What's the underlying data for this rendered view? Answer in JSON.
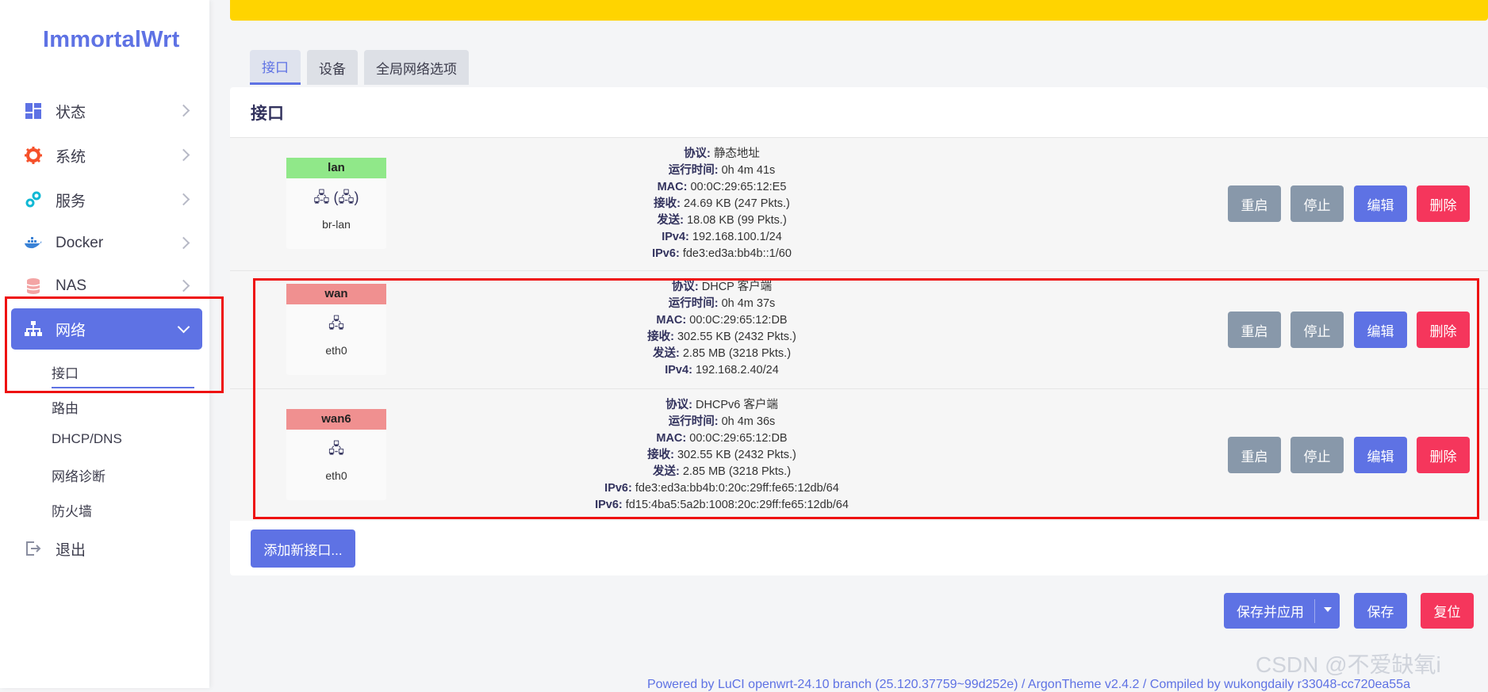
{
  "app": {
    "logo": "ImmortalWrt"
  },
  "sidebar": {
    "items": [
      {
        "label": "状态",
        "icon": "dashboard-icon"
      },
      {
        "label": "系统",
        "icon": "gear-icon"
      },
      {
        "label": "服务",
        "icon": "puzzle-icon"
      },
      {
        "label": "Docker",
        "icon": "docker-whale-icon"
      },
      {
        "label": "NAS",
        "icon": "database-icon"
      },
      {
        "label": "网络",
        "icon": "network-tree-icon"
      }
    ],
    "subitems": [
      "接口",
      "路由",
      "DHCP/DNS",
      "网络诊断",
      "防火墙"
    ],
    "logout": "退出"
  },
  "tabs": [
    "接口",
    "设备",
    "全局网络选项"
  ],
  "panel": {
    "title": "接口"
  },
  "interfaces": [
    {
      "name": "lan",
      "badge_color": "#90e889",
      "device": "br-lan",
      "icons": "🖧 (🖧)",
      "lines": [
        [
          "协议:",
          "静态地址"
        ],
        [
          "运行时间:",
          "0h 4m 41s"
        ],
        [
          "MAC:",
          "00:0C:29:65:12:E5"
        ],
        [
          "接收:",
          "24.69 KB (247 Pkts.)"
        ],
        [
          "发送:",
          "18.08 KB (99 Pkts.)"
        ],
        [
          "IPv4:",
          "192.168.100.1/24"
        ],
        [
          "IPv6:",
          "fde3:ed3a:bb4b::1/60"
        ]
      ]
    },
    {
      "name": "wan",
      "badge_color": "#f09090",
      "device": "eth0",
      "icons": "🖧",
      "lines": [
        [
          "协议:",
          "DHCP 客户端"
        ],
        [
          "运行时间:",
          "0h 4m 37s"
        ],
        [
          "MAC:",
          "00:0C:29:65:12:DB"
        ],
        [
          "接收:",
          "302.55 KB (2432 Pkts.)"
        ],
        [
          "发送:",
          "2.85 MB (3218 Pkts.)"
        ],
        [
          "IPv4:",
          "192.168.2.40/24"
        ]
      ]
    },
    {
      "name": "wan6",
      "badge_color": "#f09090",
      "device": "eth0",
      "icons": "🖧",
      "lines": [
        [
          "协议:",
          "DHCPv6 客户端"
        ],
        [
          "运行时间:",
          "0h 4m 36s"
        ],
        [
          "MAC:",
          "00:0C:29:65:12:DB"
        ],
        [
          "接收:",
          "302.55 KB (2432 Pkts.)"
        ],
        [
          "发送:",
          "2.85 MB (3218 Pkts.)"
        ],
        [
          "IPv6:",
          "fde3:ed3a:bb4b:0:20c:29ff:fe65:12db/64"
        ],
        [
          "IPv6:",
          "fd15:4ba5:5a2b:1008:20c:29ff:fe65:12db/64"
        ]
      ]
    }
  ],
  "row_buttons": {
    "restart": "重启",
    "stop": "停止",
    "edit": "编辑",
    "delete": "删除"
  },
  "add_interface": "添加新接口...",
  "footer_actions": {
    "save_apply": "保存并应用",
    "save": "保存",
    "reset": "复位"
  },
  "footer": "Powered by LuCI openwrt-24.10 branch (25.120.37759~99d252e) / ArgonTheme v2.4.2 / Compiled by wukongdaily r33048-cc720ea55a",
  "watermark": "CSDN @不爱缺氧i",
  "colors": {
    "accent": "#5e72e4",
    "danger": "#f5365c",
    "grey": "#8898aa",
    "topbar": "#ffd400",
    "highlight_box": "#ee1111"
  }
}
